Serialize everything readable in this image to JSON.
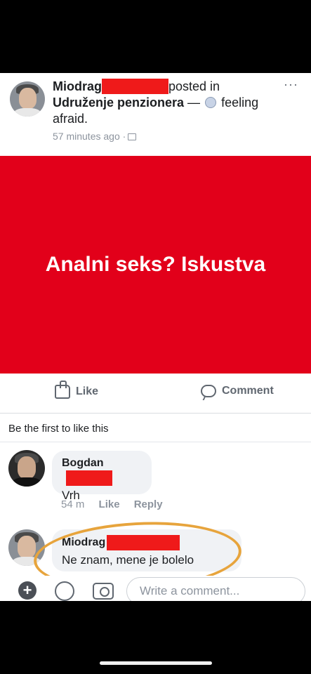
{
  "post": {
    "author": "Miodrag",
    "posted_in": "posted in",
    "group": "Udruženje penzionera",
    "feeling_prefix": "— ",
    "feeling": "feeling afraid.",
    "timestamp": "57 minutes ago ·",
    "more": "···",
    "banner_text": "Analni seks? Iskustva"
  },
  "actions": {
    "like": "Like",
    "comment": "Comment"
  },
  "first_like": "Be the first to like this",
  "comments": [
    {
      "name": "Bogdan",
      "text": "Vrh",
      "time": "54 m",
      "like": "Like",
      "reply": "Reply"
    },
    {
      "name": "Miodrag",
      "text": "Ne znam, mene je bolelo"
    }
  ],
  "composer": {
    "placeholder": "Write a comment..."
  },
  "colors": {
    "banner": "#e2001a",
    "redaction": "#ef1a1a",
    "annotation": "#e7a43c"
  },
  "icons": [
    "more-icon",
    "feeling-afraid-icon",
    "privacy-icon",
    "thumb-up-icon",
    "comment-bubble-icon",
    "plus-icon",
    "smile-icon",
    "camera-icon"
  ]
}
